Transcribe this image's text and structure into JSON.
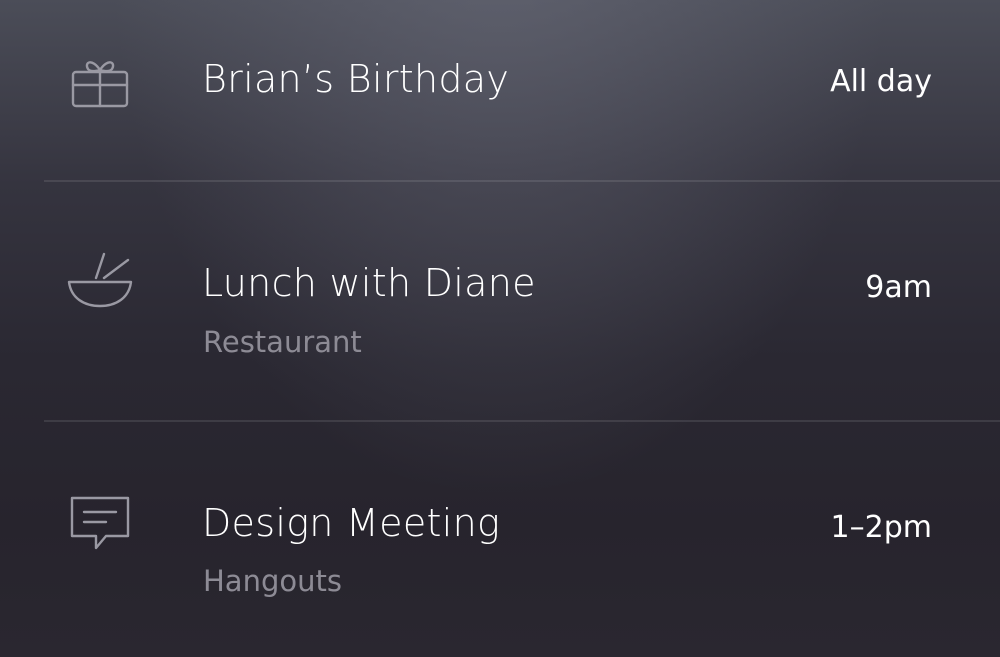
{
  "events": [
    {
      "title": "Brian’s Birthday",
      "subtitle": "",
      "time": "All day",
      "icon": "gift-icon"
    },
    {
      "title": "Lunch with Diane",
      "subtitle": "Restaurant",
      "time": "9am",
      "icon": "bowl-chopsticks-icon"
    },
    {
      "title": "Design Meeting",
      "subtitle": "Hangouts",
      "time": "1–2pm",
      "icon": "chat-bubble-icon"
    }
  ],
  "colors": {
    "text_primary": "#ffffff",
    "text_secondary": "#8d8b95",
    "icon_stroke": "#9a99a3"
  }
}
